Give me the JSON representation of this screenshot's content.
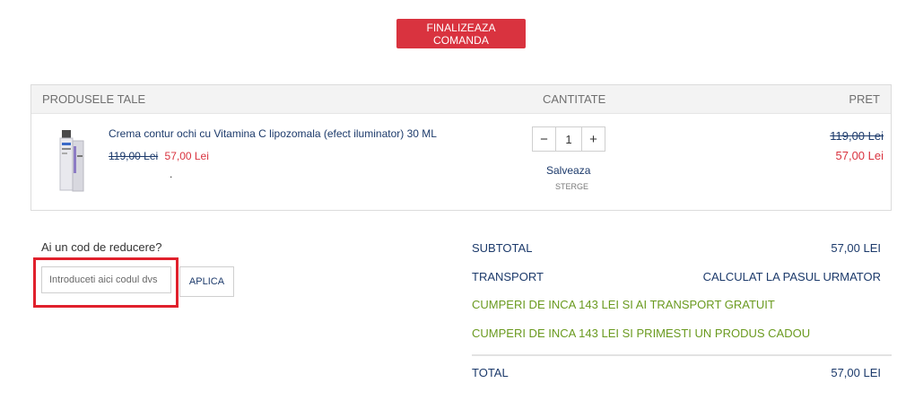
{
  "checkout": {
    "button_label": "FINALIZEAZA COMANDA"
  },
  "cart": {
    "headers": {
      "products": "PRODUSELE TALE",
      "quantity": "CANTITATE",
      "price": "PRET"
    },
    "item": {
      "name": "Crema contur ochi cu Vitamina C lipozomala (efect iluminator) 30 ML",
      "old_price": "119,00 Lei",
      "new_price": "57,00 Lei",
      "dot": ".",
      "quantity": "1",
      "minus_symbol": "−",
      "plus_symbol": "+",
      "save_label": "Salveaza",
      "delete_label": "STERGE",
      "total_old_price": "119,00 Lei",
      "total_new_price": "57,00 Lei"
    }
  },
  "discount": {
    "label": "Ai un cod de reducere?",
    "placeholder": "Introduceti aici codul dvs",
    "apply_label": "APLICA"
  },
  "summary": {
    "subtotal_label": "SUBTOTAL",
    "subtotal_value": "57,00 LEI",
    "transport_label": "TRANSPORT",
    "transport_value": "CALCULAT LA PASUL URMATOR",
    "promo_shipping": "CUMPERI DE INCA 143 LEI SI AI TRANSPORT GRATUIT",
    "promo_gift": "CUMPERI DE INCA 143 LEI SI PRIMESTI UN PRODUS CADOU",
    "total_label": "TOTAL",
    "total_value": "57,00 LEI"
  },
  "colors": {
    "accent": "#d9333f",
    "link_navy": "#1c3a6b",
    "promo_green": "#6a9a1f",
    "highlight": "#e0202c"
  }
}
